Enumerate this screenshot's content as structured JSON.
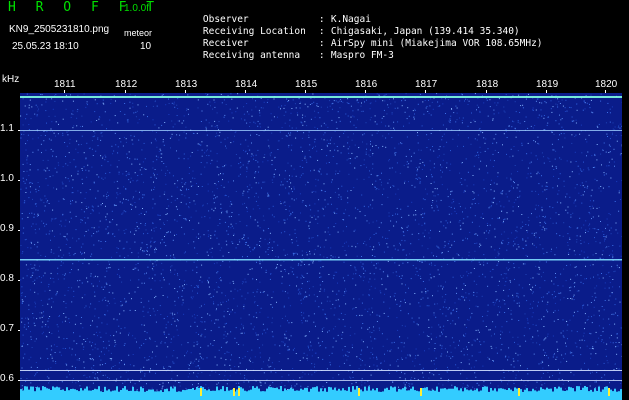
{
  "header": {
    "app_title": "H R O F F T",
    "version": "1.0.0f",
    "filename": "KN9_2505231810.png",
    "meteor_label": "meteor",
    "datetime": "25.05.23 18:10",
    "meteor_count": "10",
    "info": [
      {
        "key": "Observer",
        "sep": ":",
        "value": "K.Nagai"
      },
      {
        "key": "Receiving Location",
        "sep": ":",
        "value": "Chigasaki, Japan (139.414 35.340)"
      },
      {
        "key": "Receiver",
        "sep": ":",
        "value": "AirSpy mini (Miakejima VOR 108.65MHz)"
      },
      {
        "key": "Receiving antenna",
        "sep": ":",
        "value": "Maspro FM-3"
      }
    ]
  },
  "axes": {
    "y_unit": "kHz",
    "y_ticks": [
      "1.1",
      "1.0",
      "0.9",
      "0.8",
      "0.7",
      "0.6"
    ],
    "x_ticks": [
      "1811",
      "1812",
      "1813",
      "1814",
      "1815",
      "1816",
      "1817",
      "1818",
      "1819",
      "1820"
    ]
  },
  "colors": {
    "background": "#000000",
    "plot_bg": "#0a1c8a",
    "title_green": "#00e000",
    "signal_line": "#7fe0ff",
    "baseline": "#33ccff"
  }
}
